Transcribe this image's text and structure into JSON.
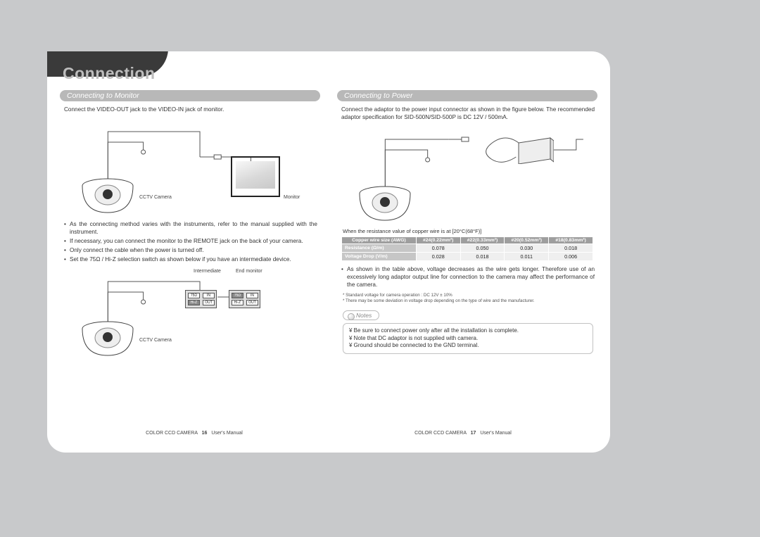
{
  "title": "Connection",
  "left": {
    "subhead": "Connecting to Monitor",
    "intro": "Connect the VIDEO-OUT jack to the VIDEO-IN jack of monitor.",
    "labels": {
      "cctv": "CCTV Camera",
      "monitor": "Monitor",
      "intermediate": "Intermediate",
      "end_monitor": "End monitor"
    },
    "bullets": [
      "As the connecting method varies with the instruments, refer to the manual supplied with the instrument.",
      "If necessary, you can connect the monitor to the REMOTE jack on the back of your camera.",
      "Only connect the cable when the power is turned off.",
      "Set the 75Ω / Hi-Z selection switch as shown below if you have an intermediate device."
    ],
    "switch_left_top": "75Ω",
    "switch_left_bot": "Hi-Z",
    "switch_right_top": "75Ω",
    "switch_right_bot": "Hi-Z",
    "switch_in": "IN",
    "switch_out": "OUT"
  },
  "right": {
    "subhead": "Connecting to Power",
    "intro": "Connect the adaptor to the power input connector as shown in the figure below. The recommended adaptor specification for SID-500N/SID-500P is DC 12V / 500mA.",
    "table_caption": "When the resistance value of copper wire is at [20°C(68°F)]",
    "table_data": {
      "col_header_row": [
        "Copper wire size (AWG)",
        "#24(0.22mm²)",
        "#22(0.33mm²)",
        "#20(0.52mm²)",
        "#18(0.83mm²)"
      ],
      "rows": [
        {
          "label": "Resistance (Ω/m)",
          "values": [
            "0.078",
            "0.050",
            "0.030",
            "0.018"
          ]
        },
        {
          "label": "Voltage Drop (V/m)",
          "values": [
            "0.028",
            "0.018",
            "0.011",
            "0.006"
          ]
        }
      ]
    },
    "after_table_bullet": "As shown in the table above, voltage decreases as the wire gets longer. Therefore use of an excessively long adaptor output line for connection to the camera may affect the performance of the camera.",
    "foot_notes": [
      "Standard voltage for camera operation : DC 12V ± 10%",
      "There may be some deviation in voltage drop depending on the type of wire and the manufacturer."
    ],
    "notes_label": "Notes",
    "notes": [
      "Be sure to connect power only after all the installation is complete.",
      "Note that DC adaptor is not supplied with camera.",
      "Ground should be connected to the GND terminal."
    ]
  },
  "footer": {
    "left_text_a": "COLOR CCD CAMERA",
    "left_page": "16",
    "left_text_b": "User's Manual",
    "right_text_a": "COLOR CCD CAMERA",
    "right_page": "17",
    "right_text_b": "User's Manual"
  },
  "chart_data": {
    "type": "table",
    "title": "Copper wire resistance and voltage drop at 20°C (68°F)",
    "columns": [
      "AWG / size",
      "Resistance (Ω/m)",
      "Voltage Drop (V/m)"
    ],
    "rows": [
      {
        "awg": "#24 (0.22 mm²)",
        "resistance_ohm_per_m": 0.078,
        "voltage_drop_v_per_m": 0.028
      },
      {
        "awg": "#22 (0.33 mm²)",
        "resistance_ohm_per_m": 0.05,
        "voltage_drop_v_per_m": 0.018
      },
      {
        "awg": "#20 (0.52 mm²)",
        "resistance_ohm_per_m": 0.03,
        "voltage_drop_v_per_m": 0.011
      },
      {
        "awg": "#18 (0.83 mm²)",
        "resistance_ohm_per_m": 0.018,
        "voltage_drop_v_per_m": 0.006
      }
    ]
  }
}
